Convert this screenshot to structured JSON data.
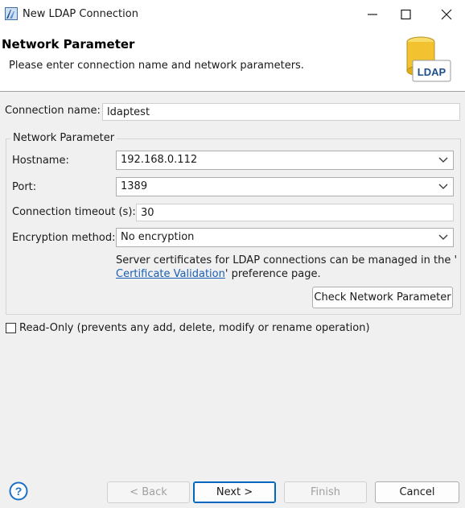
{
  "window": {
    "title": "New LDAP Connection"
  },
  "banner": {
    "title": "Network Parameter",
    "description": "Please enter connection name and network parameters.",
    "logo_text": "LDAP"
  },
  "form": {
    "connection_name_label": "Connection name:",
    "connection_name_value": "ldaptest",
    "group_title": "Network Parameter",
    "hostname_label": "Hostname:",
    "hostname_value": "192.168.0.112",
    "port_label": "Port:",
    "port_value": "1389",
    "timeout_label": "Connection timeout (s):",
    "timeout_value": "30",
    "encryption_label": "Encryption method:",
    "encryption_value": "No encryption",
    "info_text_1": "Server certificates for LDAP connections can be managed in the '",
    "info_link": "Certificate Validation",
    "info_text_2": "' preference page.",
    "check_button": "Check Network Parameter",
    "readonly_label": "Read-Only (prevents any add, delete, modify or rename operation)"
  },
  "footer": {
    "back": "< Back",
    "next": "Next >",
    "finish": "Finish",
    "cancel": "Cancel"
  },
  "icons": {
    "app": "eclipse-window-icon",
    "minimize": "minimize-icon",
    "maximize": "maximize-icon",
    "close": "close-icon",
    "chevron": "chevron-down-icon",
    "help": "help-icon",
    "logo": "ldap-database-icon"
  },
  "colors": {
    "link": "#1a5fb4",
    "primary_border": "#0067c0",
    "help": "#1e6fc4",
    "logo_cylinder": "#f2c230"
  }
}
